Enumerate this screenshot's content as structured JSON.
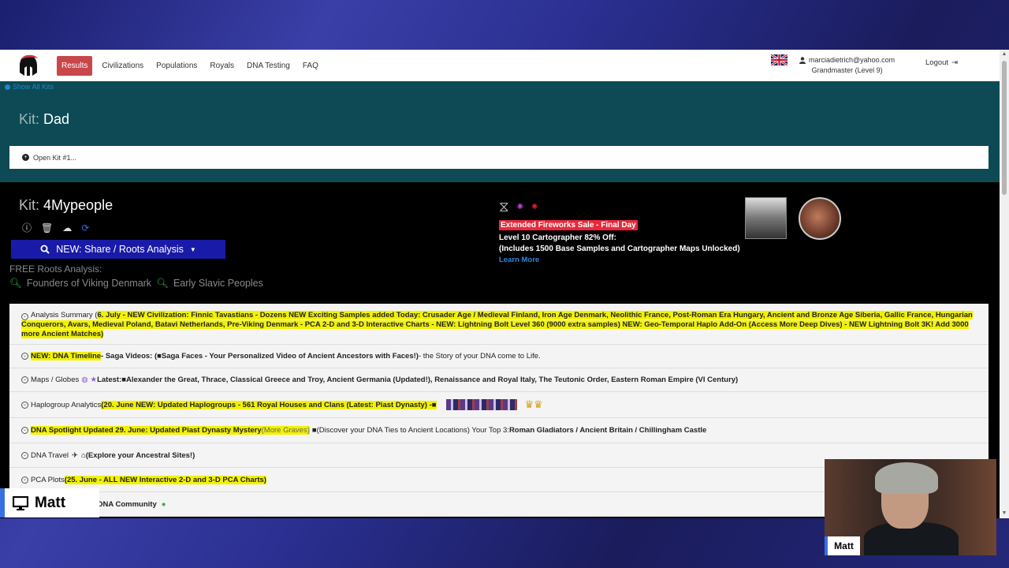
{
  "navbar": {
    "items": [
      {
        "label": "Results",
        "active": true
      },
      {
        "label": "Civilizations"
      },
      {
        "label": "Populations"
      },
      {
        "label": "Royals"
      },
      {
        "label": "DNA Testing"
      },
      {
        "label": "FAQ"
      }
    ],
    "user_email": "marciadietrich@yahoo.com",
    "user_level": "Grandmaster (Level 9)",
    "logout_label": "Logout"
  },
  "show_all_kits": "Show All Kits",
  "kit1": {
    "prefix": "Kit:",
    "name": "Dad",
    "open_label": "Open Kit #1..."
  },
  "kit2": {
    "prefix": "Kit:",
    "name": "4Mypeople"
  },
  "share_button": "NEW: Share / Roots Analysis",
  "free_roots": {
    "label": "FREE Roots Analysis:",
    "links": [
      "Founders of Viking Denmark",
      "Early Slavic Peoples"
    ]
  },
  "promo": {
    "sale": "Extended Fireworks Sale - Final Day",
    "line1": "Level 10 Cartographer 82% Off:",
    "line2": "(Includes 1500 Base Samples and Cartographer Maps Unlocked)",
    "learn_more": "Learn More"
  },
  "rows": {
    "analysis_label": "Analysis Summary (",
    "analysis_text": "6. July - NEW Civilization: Finnic Tavastians - Dozens NEW Exciting Samples added Today: Crusader Age / Medieval Finland, Iron Age Denmark, Neolithic France, Post-Roman Era Hungary, Ancient and Bronze Age Siberia, Gallic France, Hungarian Conquerors, Avars, Medieval Poland, Batavi Netherlands, Pre-Viking Denmark - PCA 2-D and 3-D Interactive Charts - NEW: Lightning Bolt Level 360 (9000 extra samples) NEW: Geo-Temporal Haplo Add-On (Access More Deep Dives) - NEW Lightning Bolt 3K! Add 3000 more Ancient Matches)",
    "timeline_hl": "NEW: DNA Timeline",
    "timeline_mid": " - Saga Videos: (",
    "timeline_bold": " Saga Faces - Your Personalized Video of Ancient Ancestors with Faces!)",
    "timeline_end": " - the Story of your DNA come to Life.",
    "maps_label": "Maps / Globes",
    "maps_latest": " Latest: ",
    "maps_text": " Alexander the Great, Thrace, Classical Greece and Troy, Ancient Germania (Updated!), Renaissance and Royal Italy, The Teutonic Order, Eastern Roman Empire (VI Century)",
    "haplo_label": "Haplogroup Analytics ",
    "haplo_hl": "(20. June NEW: Updated Haplogroups - 561 Royal Houses and Clans (Latest: Piast Dynasty) - ",
    "spot_hl": "DNA Spotlight Updated 29. June: Updated Piast Dynasty Mystery ",
    "spot_more": "(More Graves)",
    "spot_mid": " (Discover your DNA Ties to Ancient Locations) Your Top 3: ",
    "spot_bold": "Roman Gladiators / Ancient Britain / Chillingham Castle",
    "travel_label": "DNA Travel ",
    "travel_bold": " (Explore your Ancestral Sites!)",
    "pca_label": "PCA Plots ",
    "pca_hl": "(25. June - ALL NEW Interactive 2-D and 3-D PCA Charts)",
    "community": "nt DNA Community"
  },
  "overlay": {
    "name": "Matt",
    "webcam_label": "Matt"
  }
}
